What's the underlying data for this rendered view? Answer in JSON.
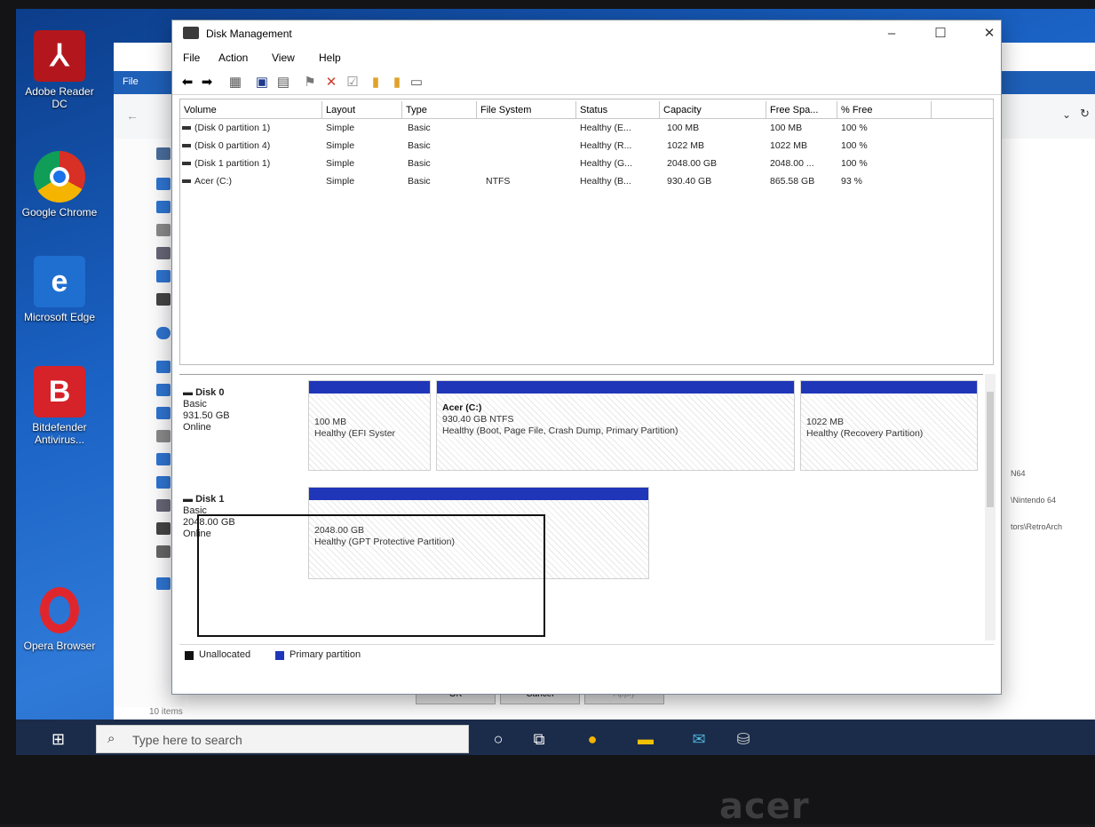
{
  "desktop": {
    "icons": [
      {
        "label": "Adobe Reader DC",
        "icon": "acrobat-icon"
      },
      {
        "label": "Google Chrome",
        "icon": "chrome-icon"
      },
      {
        "label": "Microsoft Edge",
        "icon": "edge-icon"
      },
      {
        "label": "Bitdefender Antivirus...",
        "icon": "bitdefender-icon"
      },
      {
        "label": "Opera Browser",
        "icon": "opera-icon"
      }
    ]
  },
  "explorer": {
    "ribbon_label": "File",
    "status": "10 items",
    "right_items": [
      "N64",
      "\\Nintendo 64",
      "tors\\RetroArch"
    ],
    "ok_label": "OK",
    "cancel_label": "Cancel",
    "apply_label": "Apply"
  },
  "window": {
    "title": "Disk Management",
    "minimize": "–",
    "maximize": "☐",
    "close": "✕",
    "menu": [
      "File",
      "Action",
      "View",
      "Help"
    ]
  },
  "volume_list": {
    "columns": [
      "Volume",
      "Layout",
      "Type",
      "File System",
      "Status",
      "Capacity",
      "Free Spa...",
      "% Free"
    ],
    "rows": [
      {
        "volume": "(Disk 0 partition 1)",
        "layout": "Simple",
        "type": "Basic",
        "fs": "",
        "status": "Healthy (E...",
        "capacity": "100 MB",
        "free": "100 MB",
        "pct": "100 %"
      },
      {
        "volume": "(Disk 0 partition 4)",
        "layout": "Simple",
        "type": "Basic",
        "fs": "",
        "status": "Healthy (R...",
        "capacity": "1022 MB",
        "free": "1022 MB",
        "pct": "100 %"
      },
      {
        "volume": "(Disk 1 partition 1)",
        "layout": "Simple",
        "type": "Basic",
        "fs": "",
        "status": "Healthy (G...",
        "capacity": "2048.00 GB",
        "free": "2048.00 ...",
        "pct": "100 %"
      },
      {
        "volume": "Acer (C:)",
        "layout": "Simple",
        "type": "Basic",
        "fs": "NTFS",
        "status": "Healthy (B...",
        "capacity": "930.40 GB",
        "free": "865.58 GB",
        "pct": "93 %"
      }
    ]
  },
  "disk_map": {
    "disk0": {
      "name": "Disk 0",
      "kind": "Basic",
      "size": "931.50 GB",
      "state": "Online",
      "p1": {
        "size": "100 MB",
        "status": "Healthy (EFI Syster"
      },
      "p2": {
        "name": "Acer  (C:)",
        "size": "930.40 GB NTFS",
        "status": "Healthy (Boot, Page File, Crash Dump, Primary Partition)"
      },
      "p3": {
        "size": "1022 MB",
        "status": "Healthy (Recovery Partition)"
      }
    },
    "disk1": {
      "name": "Disk 1",
      "kind": "Basic",
      "size": "2048.00 GB",
      "state": "Online",
      "p1": {
        "size": "2048.00 GB",
        "status": "Healthy (GPT Protective Partition)"
      }
    },
    "legend": {
      "unallocated": "Unallocated",
      "primary": "Primary partition"
    }
  },
  "taskbar": {
    "search_placeholder": "Type here to search"
  },
  "bezel": {
    "brand": "acer"
  },
  "colors": {
    "partition_bar": "#1f36b8",
    "unallocated": "#111111",
    "desktop": "#1a62c4"
  }
}
